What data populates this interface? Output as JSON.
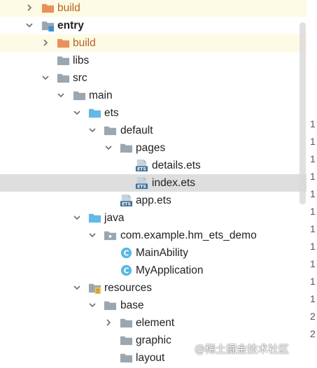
{
  "tree": [
    {
      "name": "build",
      "icon": "folder-orange",
      "expanded": false
    },
    {
      "name": "entry",
      "icon": "module-folder",
      "expanded": true
    },
    {
      "name": "build",
      "icon": "folder-orange",
      "expanded": false
    },
    {
      "name": "libs",
      "icon": "folder"
    },
    {
      "name": "src",
      "icon": "folder",
      "expanded": true
    },
    {
      "name": "main",
      "icon": "folder",
      "expanded": true
    },
    {
      "name": "ets",
      "icon": "folder-blue",
      "expanded": true
    },
    {
      "name": "default",
      "icon": "folder",
      "expanded": true
    },
    {
      "name": "pages",
      "icon": "folder",
      "expanded": true
    },
    {
      "name": "details.ets",
      "icon": "ets-file"
    },
    {
      "name": "index.ets",
      "icon": "ets-file",
      "selected": true
    },
    {
      "name": "app.ets",
      "icon": "ets-file"
    },
    {
      "name": "java",
      "icon": "folder-blue",
      "expanded": true
    },
    {
      "name": "com.example.hm_ets_demo",
      "icon": "package-folder",
      "expanded": true
    },
    {
      "name": "MainAbility",
      "icon": "class-icon"
    },
    {
      "name": "MyApplication",
      "icon": "class-icon"
    },
    {
      "name": "resources",
      "icon": "resources-folder",
      "expanded": true
    },
    {
      "name": "base",
      "icon": "folder",
      "expanded": true
    },
    {
      "name": "element",
      "icon": "folder",
      "expanded": false
    },
    {
      "name": "graphic",
      "icon": "folder"
    },
    {
      "name": "layout",
      "icon": "folder"
    }
  ],
  "gutter_numbers": [
    "1",
    "1",
    "1",
    "1",
    "1",
    "1",
    "1",
    "1",
    "1",
    "1",
    "1",
    "2",
    "2"
  ],
  "watermark": "@稀土掘金技术社区",
  "colors": {
    "folder": "#9aa7b0",
    "folder_orange": "#e8915a",
    "folder_blue": "#62b8e6",
    "class_circle": "#5ab8e4",
    "ets_icon": "#40709a",
    "selection": "#dedede",
    "highlight_yellow": "#fdfbe5"
  }
}
